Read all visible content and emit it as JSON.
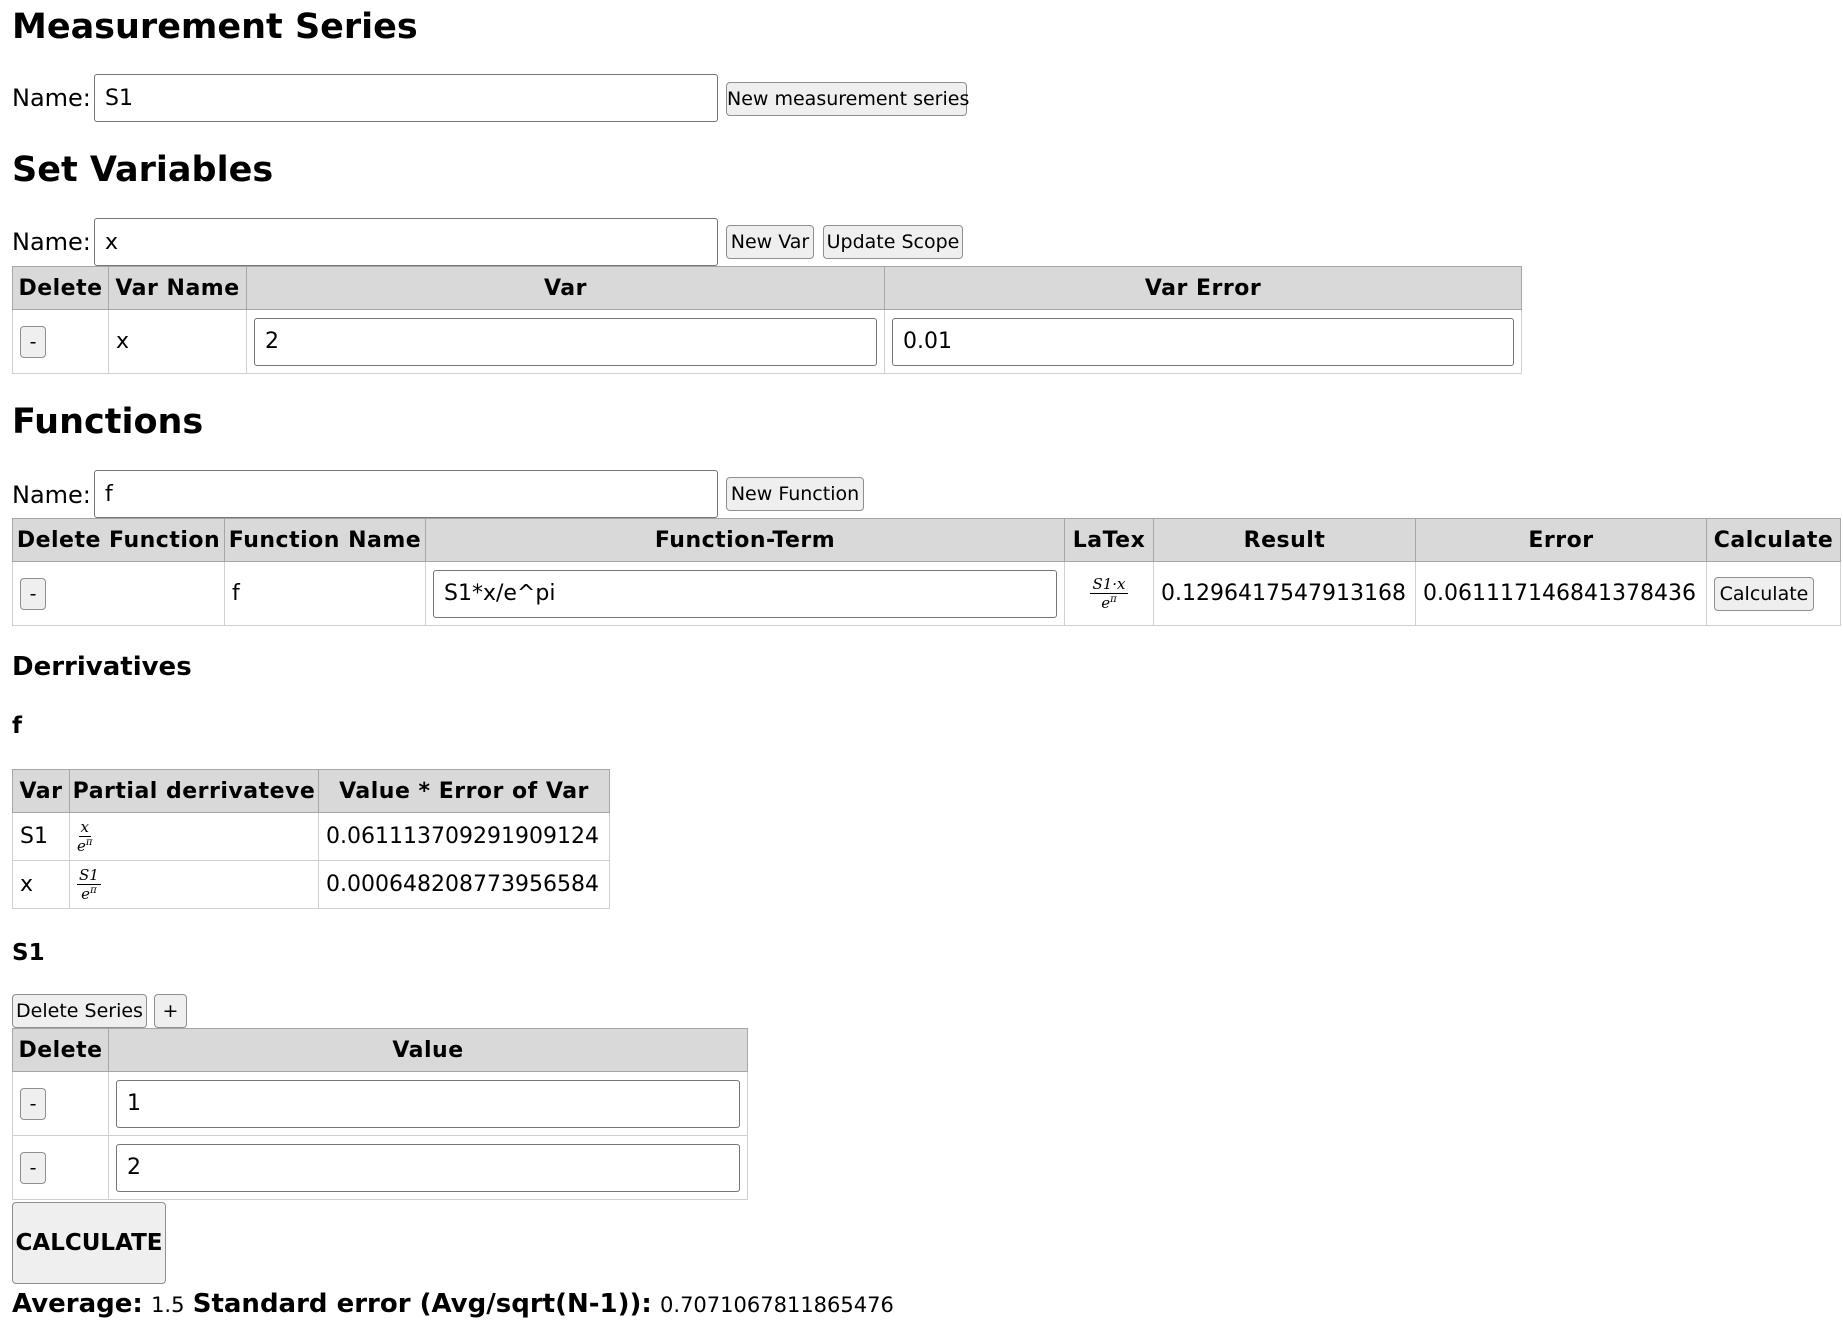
{
  "measurement_series": {
    "heading": "Measurement Series",
    "name_label": "Name:",
    "name_value": "S1",
    "new_button": "New measurement series"
  },
  "set_variables": {
    "heading": "Set Variables",
    "name_label": "Name:",
    "name_value": "x",
    "new_var_button": "New Var",
    "update_scope_button": "Update Scope",
    "table": {
      "headers": [
        "Delete",
        "Var Name",
        "Var",
        "Var Error"
      ],
      "rows": [
        {
          "delete": "-",
          "name": "x",
          "var": "2",
          "error": "0.01"
        }
      ]
    }
  },
  "functions": {
    "heading": "Functions",
    "name_label": "Name:",
    "name_value": "f",
    "new_button": "New Function",
    "table": {
      "headers": [
        "Delete Function",
        "Function Name",
        "Function-Term",
        "LaTex",
        "Result",
        "Error",
        "Calculate"
      ],
      "rows": [
        {
          "delete": "-",
          "name": "f",
          "term": "S1*x/e^pi",
          "latex_num": "S1·x",
          "latex_den": "e",
          "latex_den_sup": "π",
          "result": "0.1296417547913168",
          "error": "0.061117146841378436",
          "calculate": "Calculate"
        }
      ]
    }
  },
  "derivatives": {
    "heading": "Derrivatives",
    "function_heading": "f",
    "table": {
      "headers": [
        "Var",
        "Partial derrivateve",
        "Value * Error of Var"
      ],
      "rows": [
        {
          "var": "S1",
          "num": "x",
          "den": "e",
          "den_sup": "π",
          "value": "0.061113709291909124"
        },
        {
          "var": "x",
          "num": "S1",
          "den": "e",
          "den_sup": "π",
          "value": "0.000648208773956584"
        }
      ]
    }
  },
  "series": {
    "heading": "S1",
    "delete_series_button": "Delete Series",
    "add_button": "+",
    "table": {
      "headers": [
        "Delete",
        "Value"
      ],
      "rows": [
        {
          "delete": "-",
          "value": "1"
        },
        {
          "delete": "-",
          "value": "2"
        }
      ]
    },
    "calculate_button": "CALCULATE",
    "average_label": "Average:",
    "average_value": "1.5",
    "stderr_label": "Standard error (Avg/sqrt(N-1)):",
    "stderr_value": "0.7071067811865476"
  }
}
